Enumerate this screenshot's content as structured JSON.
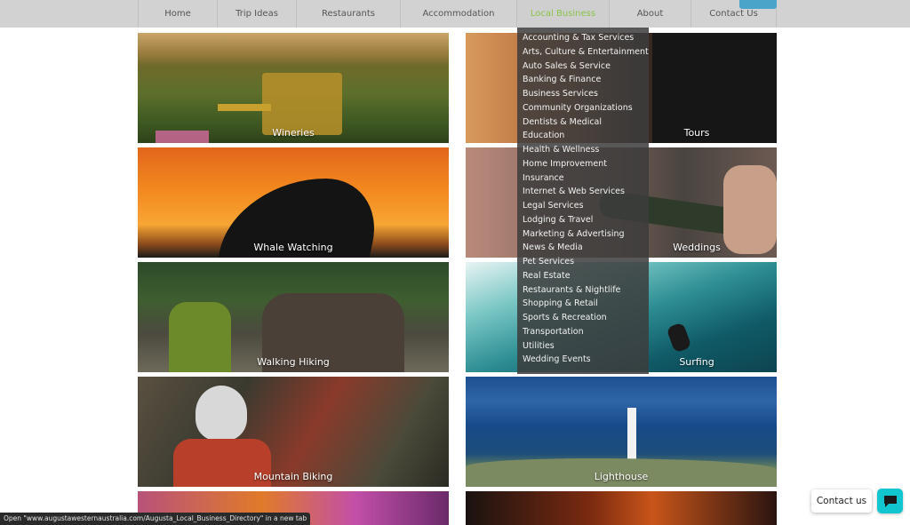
{
  "nav": {
    "items": [
      {
        "label": "Home"
      },
      {
        "label": "Trip Ideas"
      },
      {
        "label": "Restaurants"
      },
      {
        "label": "Accommodation"
      },
      {
        "label": "Local Business"
      },
      {
        "label": "About"
      },
      {
        "label": "Contact Us"
      }
    ],
    "active_color": "#8bc34a"
  },
  "tiles": [
    {
      "label": "Wineries"
    },
    {
      "label": "Tours"
    },
    {
      "label": "Whale Watching"
    },
    {
      "label": "Weddings"
    },
    {
      "label": "Walking Hiking"
    },
    {
      "label": "Surfing"
    },
    {
      "label": "Mountain Biking"
    },
    {
      "label": "Lighthouse"
    }
  ],
  "dropdown": {
    "items": [
      "Accounting & Tax Services",
      "Arts, Culture & Entertainment",
      "Auto Sales & Service",
      "Banking & Finance",
      "Business Services",
      "Community Organizations",
      "Dentists & Medical",
      "Education",
      "Health & Wellness",
      "Home Improvement",
      "Insurance",
      "Internet & Web Services",
      "Legal Services",
      "Lodging & Travel",
      "Marketing & Advertising",
      "News & Media",
      "Pet Services",
      "Real Estate",
      "Restaurants & Nightlife",
      "Shopping & Retail",
      "Sports & Recreation",
      "Transportation",
      "Utilities",
      "Wedding Events"
    ]
  },
  "status_bar": {
    "text": "Open \"www.augustawesternaustralia.com/Augusta_Local_Business_Directory\" in a new tab"
  },
  "contact_widget": {
    "label": "Contact us",
    "icon": "chat-icon",
    "color": "#12c6cf"
  }
}
